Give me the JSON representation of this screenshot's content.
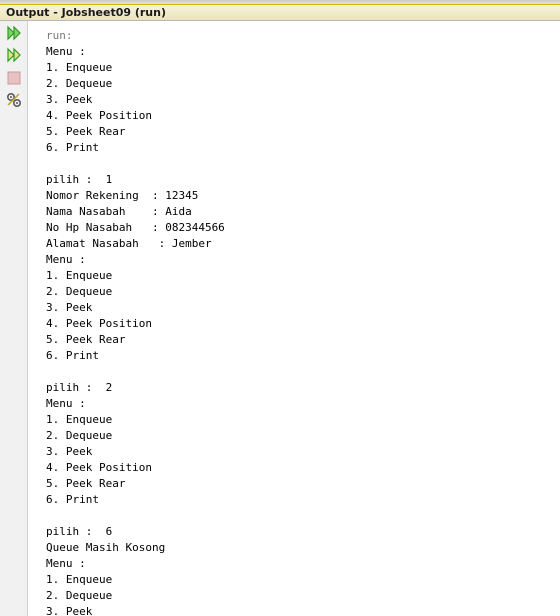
{
  "window": {
    "title": "Output - Jobsheet09 (run)"
  },
  "toolbar": {
    "buttons": [
      {
        "name": "rerun-icon",
        "color": "#2e9b1b"
      },
      {
        "name": "rerun-with-options-icon",
        "color": "#2e9b1b"
      },
      {
        "name": "stop-icon",
        "color": "#d9a3a3"
      },
      {
        "name": "settings-icon",
        "color": "#6b6b6b"
      }
    ]
  },
  "console": {
    "lines": [
      "run:",
      "Menu :",
      "1. Enqueue",
      "2. Dequeue",
      "3. Peek",
      "4. Peek Position",
      "5. Peek Rear",
      "6. Print",
      "",
      "pilih :  1",
      "Nomor Rekening  : 12345",
      "Nama Nasabah    : Aida",
      "No Hp Nasabah   : 082344566",
      "Alamat Nasabah   : Jember",
      "Menu :",
      "1. Enqueue",
      "2. Dequeue",
      "3. Peek",
      "4. Peek Position",
      "5. Peek Rear",
      "6. Print",
      "",
      "pilih :  2",
      "Menu :",
      "1. Enqueue",
      "2. Dequeue",
      "3. Peek",
      "4. Peek Position",
      "5. Peek Rear",
      "6. Print",
      "",
      "pilih :  6",
      "Queue Masih Kosong",
      "Menu :",
      "1. Enqueue",
      "2. Dequeue",
      "3. Peek"
    ]
  }
}
